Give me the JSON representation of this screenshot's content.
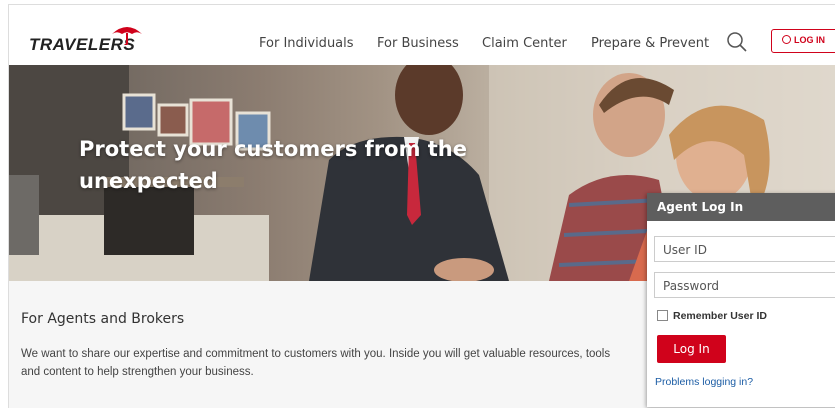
{
  "header": {
    "logo_text": "TRAVELERS",
    "nav": [
      {
        "label": "For Individuals"
      },
      {
        "label": "For Business"
      },
      {
        "label": "Claim Center"
      },
      {
        "label": "Prepare & Prevent"
      }
    ],
    "login_label": "LOG IN",
    "icons": {
      "search": "search-icon",
      "user": "user-circle-icon",
      "umbrella": "umbrella-logo-icon"
    }
  },
  "hero": {
    "title": "Protect your customers from the unexpected"
  },
  "content": {
    "title": "For Agents and Brokers",
    "body": "We want to share our expertise and commitment to customers with you. Inside you will get valuable resources, tools and content to help strengthen your business."
  },
  "agent_login": {
    "heading": "Agent Log In",
    "user_id_placeholder": "User ID",
    "password_placeholder": "Password",
    "remember_label": "Remember User ID",
    "button_label": "Log In",
    "problems_link": "Problems logging in?"
  },
  "colors": {
    "brand_red": "#d0021b",
    "panel_header": "#5e5e5e",
    "link_blue": "#1c5da5"
  }
}
